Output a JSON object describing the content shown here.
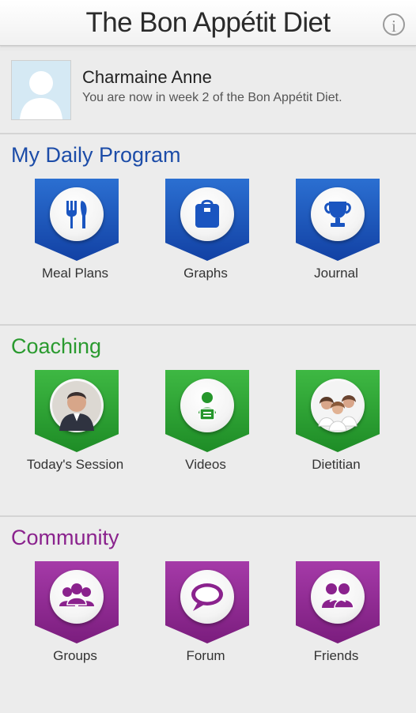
{
  "header": {
    "title": "The Bon Appétit Diet",
    "info_icon": "i"
  },
  "profile": {
    "name": "Charmaine Anne",
    "status": "You are now in week 2 of the Bon Appétit Diet."
  },
  "sections": [
    {
      "title": "My Daily Program",
      "color": "#1c4ca8",
      "items": [
        {
          "label": "Meal Plans",
          "icon": "fork-knife-icon"
        },
        {
          "label": "Graphs",
          "icon": "scale-icon"
        },
        {
          "label": "Journal",
          "icon": "trophy-icon"
        }
      ]
    },
    {
      "title": "Coaching",
      "color": "#2a9a2f",
      "items": [
        {
          "label": "Today's Session",
          "icon": "coach-photo-icon"
        },
        {
          "label": "Videos",
          "icon": "video-presenter-icon"
        },
        {
          "label": "Dietitian",
          "icon": "dietitian-photo-icon"
        }
      ]
    },
    {
      "title": "Community",
      "color": "#8a228d",
      "items": [
        {
          "label": "Groups",
          "icon": "group-icon"
        },
        {
          "label": "Forum",
          "icon": "speech-bubble-icon"
        },
        {
          "label": "Friends",
          "icon": "friends-icon"
        }
      ]
    }
  ]
}
